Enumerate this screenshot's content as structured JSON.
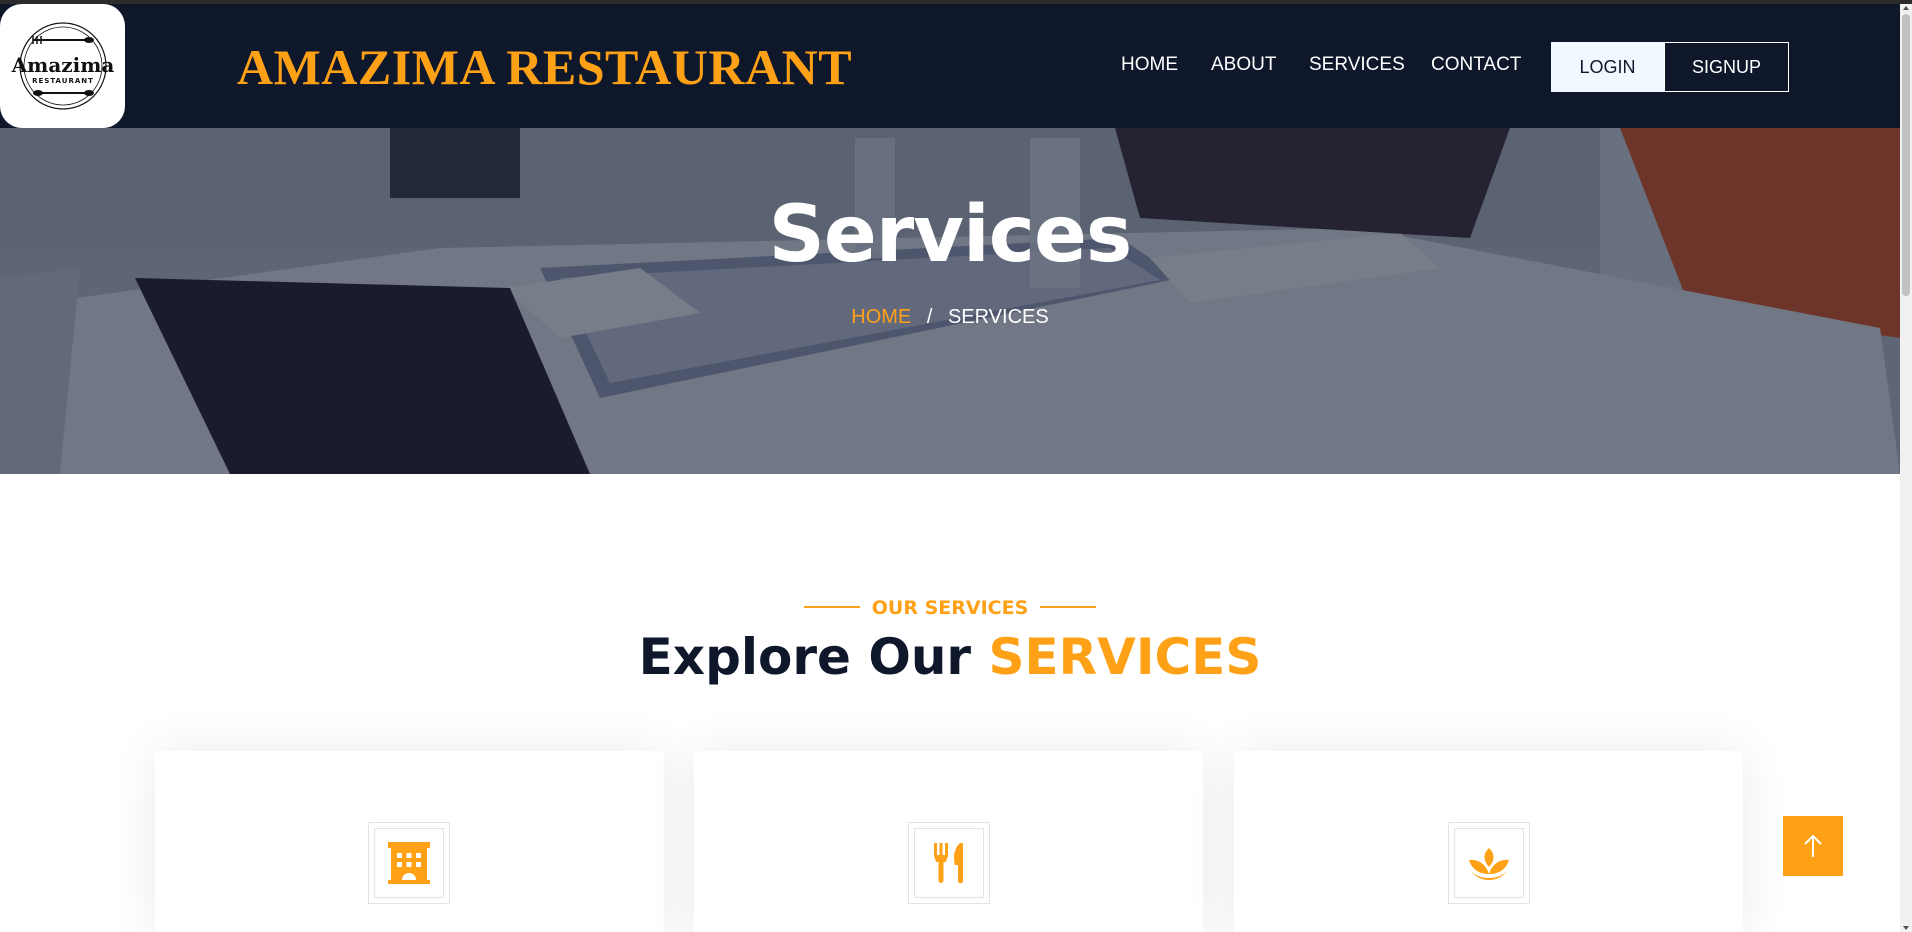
{
  "header": {
    "logo": {
      "text": "Amazima",
      "subtext": "RESTAURANT"
    },
    "brand": "AMAZIMA RESTAURANT",
    "nav": [
      {
        "label": "HOME"
      },
      {
        "label": "ABOUT"
      },
      {
        "label": "SERVICES"
      },
      {
        "label": "CONTACT"
      }
    ],
    "login_label": "LOGIN",
    "signup_label": "SIGNUP"
  },
  "hero": {
    "title": "Services",
    "breadcrumb": {
      "home": "HOME",
      "separator": "/",
      "current": "SERVICES"
    }
  },
  "section": {
    "tag": "OUR SERVICES",
    "title_main": "Explore Our",
    "title_accent": "SERVICES"
  },
  "cards": [
    {
      "icon": "hotel-icon"
    },
    {
      "icon": "utensils-icon"
    },
    {
      "icon": "spa-icon"
    }
  ],
  "colors": {
    "primary": "#fea116",
    "dark": "#0f172b",
    "light": "#f1f8ff"
  },
  "icons": {
    "back_to_top": "arrow-up-icon"
  }
}
